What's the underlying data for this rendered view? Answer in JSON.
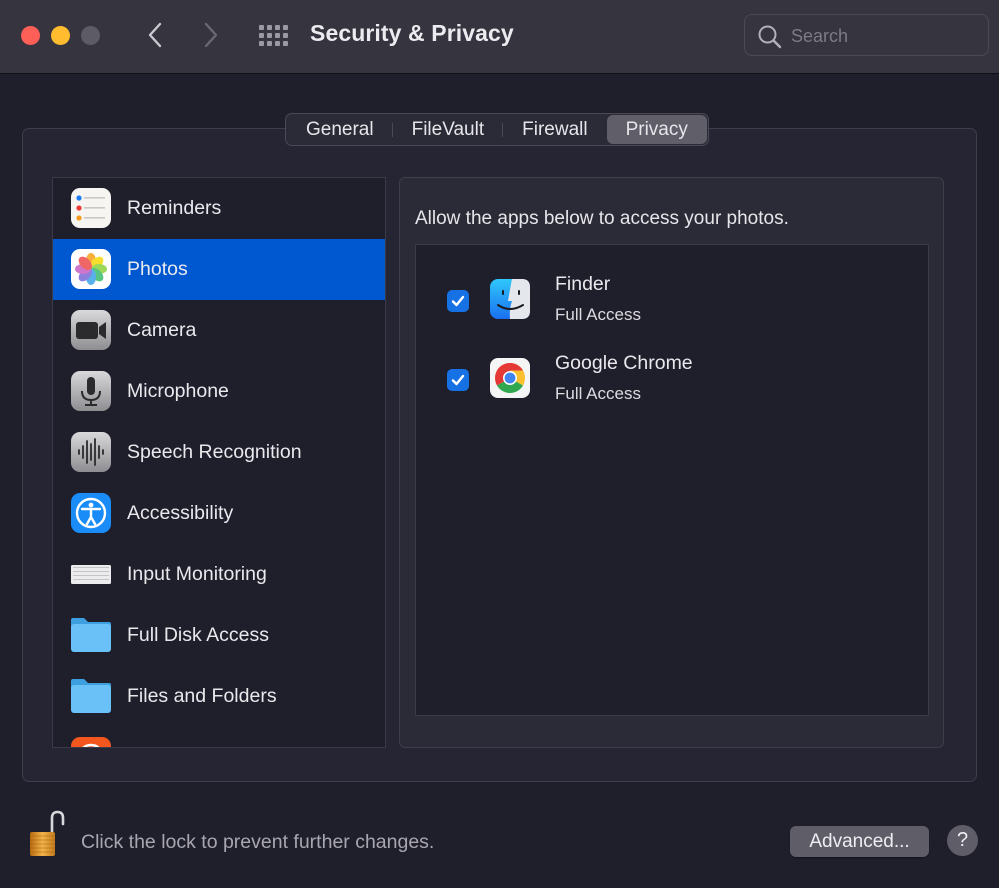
{
  "window": {
    "title": "Security & Privacy",
    "search_placeholder": "Search",
    "icons": {
      "close": "close-traffic-light",
      "minimize": "minimize-traffic-light",
      "zoom": "zoom-traffic-light",
      "back": "chevron-left-icon",
      "forward": "chevron-right-icon",
      "show_all": "grid-icon",
      "search": "search-icon"
    }
  },
  "tabs": [
    {
      "label": "General",
      "active": false
    },
    {
      "label": "FileVault",
      "active": false
    },
    {
      "label": "Firewall",
      "active": false
    },
    {
      "label": "Privacy",
      "active": true
    }
  ],
  "sidebar": {
    "items": [
      {
        "label": "Reminders",
        "icon": "reminders-icon",
        "selected": false
      },
      {
        "label": "Photos",
        "icon": "photos-icon",
        "selected": true
      },
      {
        "label": "Camera",
        "icon": "camera-icon",
        "selected": false
      },
      {
        "label": "Microphone",
        "icon": "microphone-icon",
        "selected": false
      },
      {
        "label": "Speech Recognition",
        "icon": "speech-recognition-icon",
        "selected": false
      },
      {
        "label": "Accessibility",
        "icon": "accessibility-icon",
        "selected": false
      },
      {
        "label": "Input Monitoring",
        "icon": "keyboard-icon",
        "selected": false
      },
      {
        "label": "Full Disk Access",
        "icon": "folder-icon",
        "selected": false
      },
      {
        "label": "Files and Folders",
        "icon": "folder-icon",
        "selected": false
      },
      {
        "label": "",
        "icon": "partially-visible-icon",
        "selected": false
      }
    ]
  },
  "content": {
    "description": "Allow the apps below to access your photos.",
    "apps": [
      {
        "name": "Finder",
        "access": "Full Access",
        "checked": true,
        "icon": "finder-icon"
      },
      {
        "name": "Google Chrome",
        "access": "Full Access",
        "checked": true,
        "icon": "chrome-icon"
      }
    ]
  },
  "footer": {
    "lock_text": "Click the lock to prevent further changes.",
    "advanced_label": "Advanced...",
    "help_label": "?"
  },
  "colors": {
    "accent": "#0058d0",
    "checkbox": "#1672e4",
    "close": "#fe5f57",
    "minimize": "#febc2e"
  }
}
